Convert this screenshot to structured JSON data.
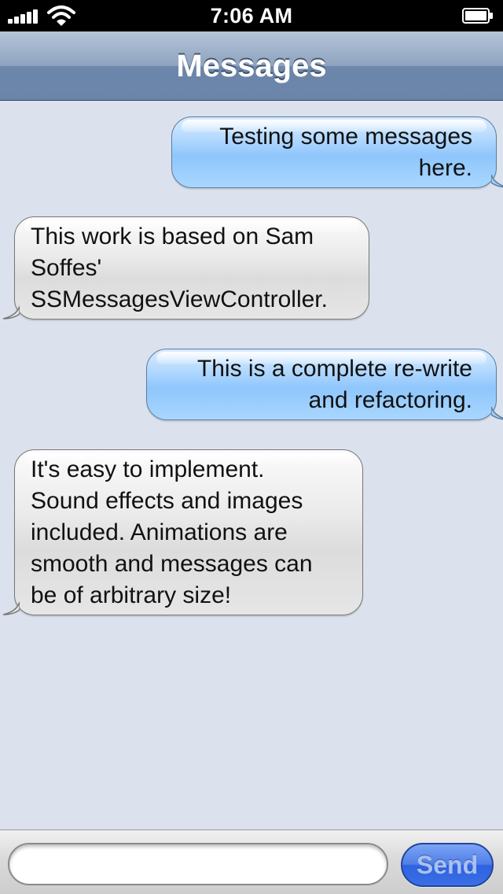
{
  "status_bar": {
    "time": "7:06 AM",
    "signal_icon": "signal-bars-icon",
    "wifi_icon": "wifi-icon",
    "battery_icon": "battery-icon"
  },
  "nav": {
    "title": "Messages"
  },
  "messages": [
    {
      "direction": "outgoing",
      "text": "Testing some messages\nhere."
    },
    {
      "direction": "incoming",
      "text": "This work is based on Sam\nSoffes'\nSSMessagesViewController."
    },
    {
      "direction": "outgoing",
      "text": "This is a complete re-write\nand refactoring."
    },
    {
      "direction": "incoming",
      "text": "It's easy to implement.\nSound effects and images\nincluded. Animations are\nsmooth and messages can\nbe of arbitrary size!"
    }
  ],
  "input": {
    "value": "",
    "placeholder": ""
  },
  "send_button": {
    "label": "Send"
  },
  "colors": {
    "background": "#dbe2ed",
    "outgoing_bubble": "#a9d6fe",
    "incoming_bubble": "#e6e6e6",
    "nav_bar": "#8ea3c0",
    "send_button": "#3b6fe6"
  }
}
